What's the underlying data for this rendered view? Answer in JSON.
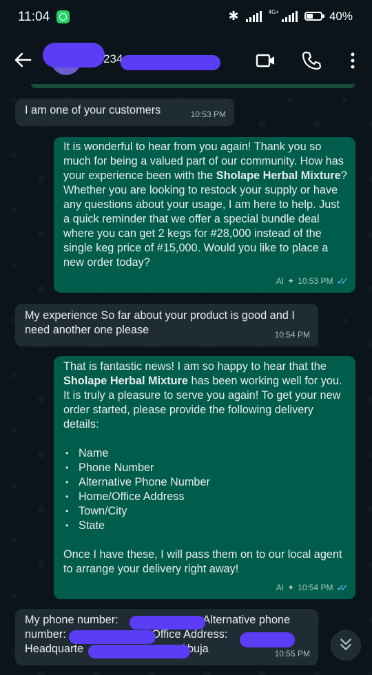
{
  "status": {
    "time": "11:04",
    "network": "4G+",
    "battery": "40%"
  },
  "header": {
    "contact_visible": "234"
  },
  "messages": [
    {
      "dir": "in",
      "text": "I am one of your customers",
      "time": "10:53 PM"
    },
    {
      "dir": "out",
      "p1": "It is wonderful to hear from you again! Thank you so much for being a valued part of our community. How has your experience been with the ",
      "bold": "Sholape Herbal Mixture",
      "p2": "? Whether you are looking to restock your supply or have any questions about your usage, I am here to help. Just a quick reminder that we offer a special bundle deal where you can get 2 kegs for #28,000 instead of the single keg price of #15,000. Would you like to place a new order today?",
      "ai": "AI",
      "time": "10:53 PM"
    },
    {
      "dir": "in",
      "text": "My experience So far about your product is good and I need another one please",
      "time": "10:54 PM"
    },
    {
      "dir": "out",
      "p1": "That is fantastic news! I am so happy to hear that the ",
      "bold": "Sholape Herbal Mixture",
      "p2": " has been working well for you. It is truly a pleasure to serve you again! To get your new order started, please provide the following delivery details:",
      "list": [
        "Name",
        "Phone Number",
        "Alternative Phone Number",
        "Home/Office Address",
        "Town/City",
        "State"
      ],
      "p3": "Once I have these, I will pass them on to our local agent to arrange your delivery right away!",
      "ai": "AI",
      "time": "10:54 PM"
    },
    {
      "dir": "in",
      "a": "My phone number: ",
      "b": ", Alternative phone number: ",
      "c": "Office Address: ",
      "d": "Headquarte",
      "e": "Abuja",
      "time": "10:55 PM"
    }
  ]
}
